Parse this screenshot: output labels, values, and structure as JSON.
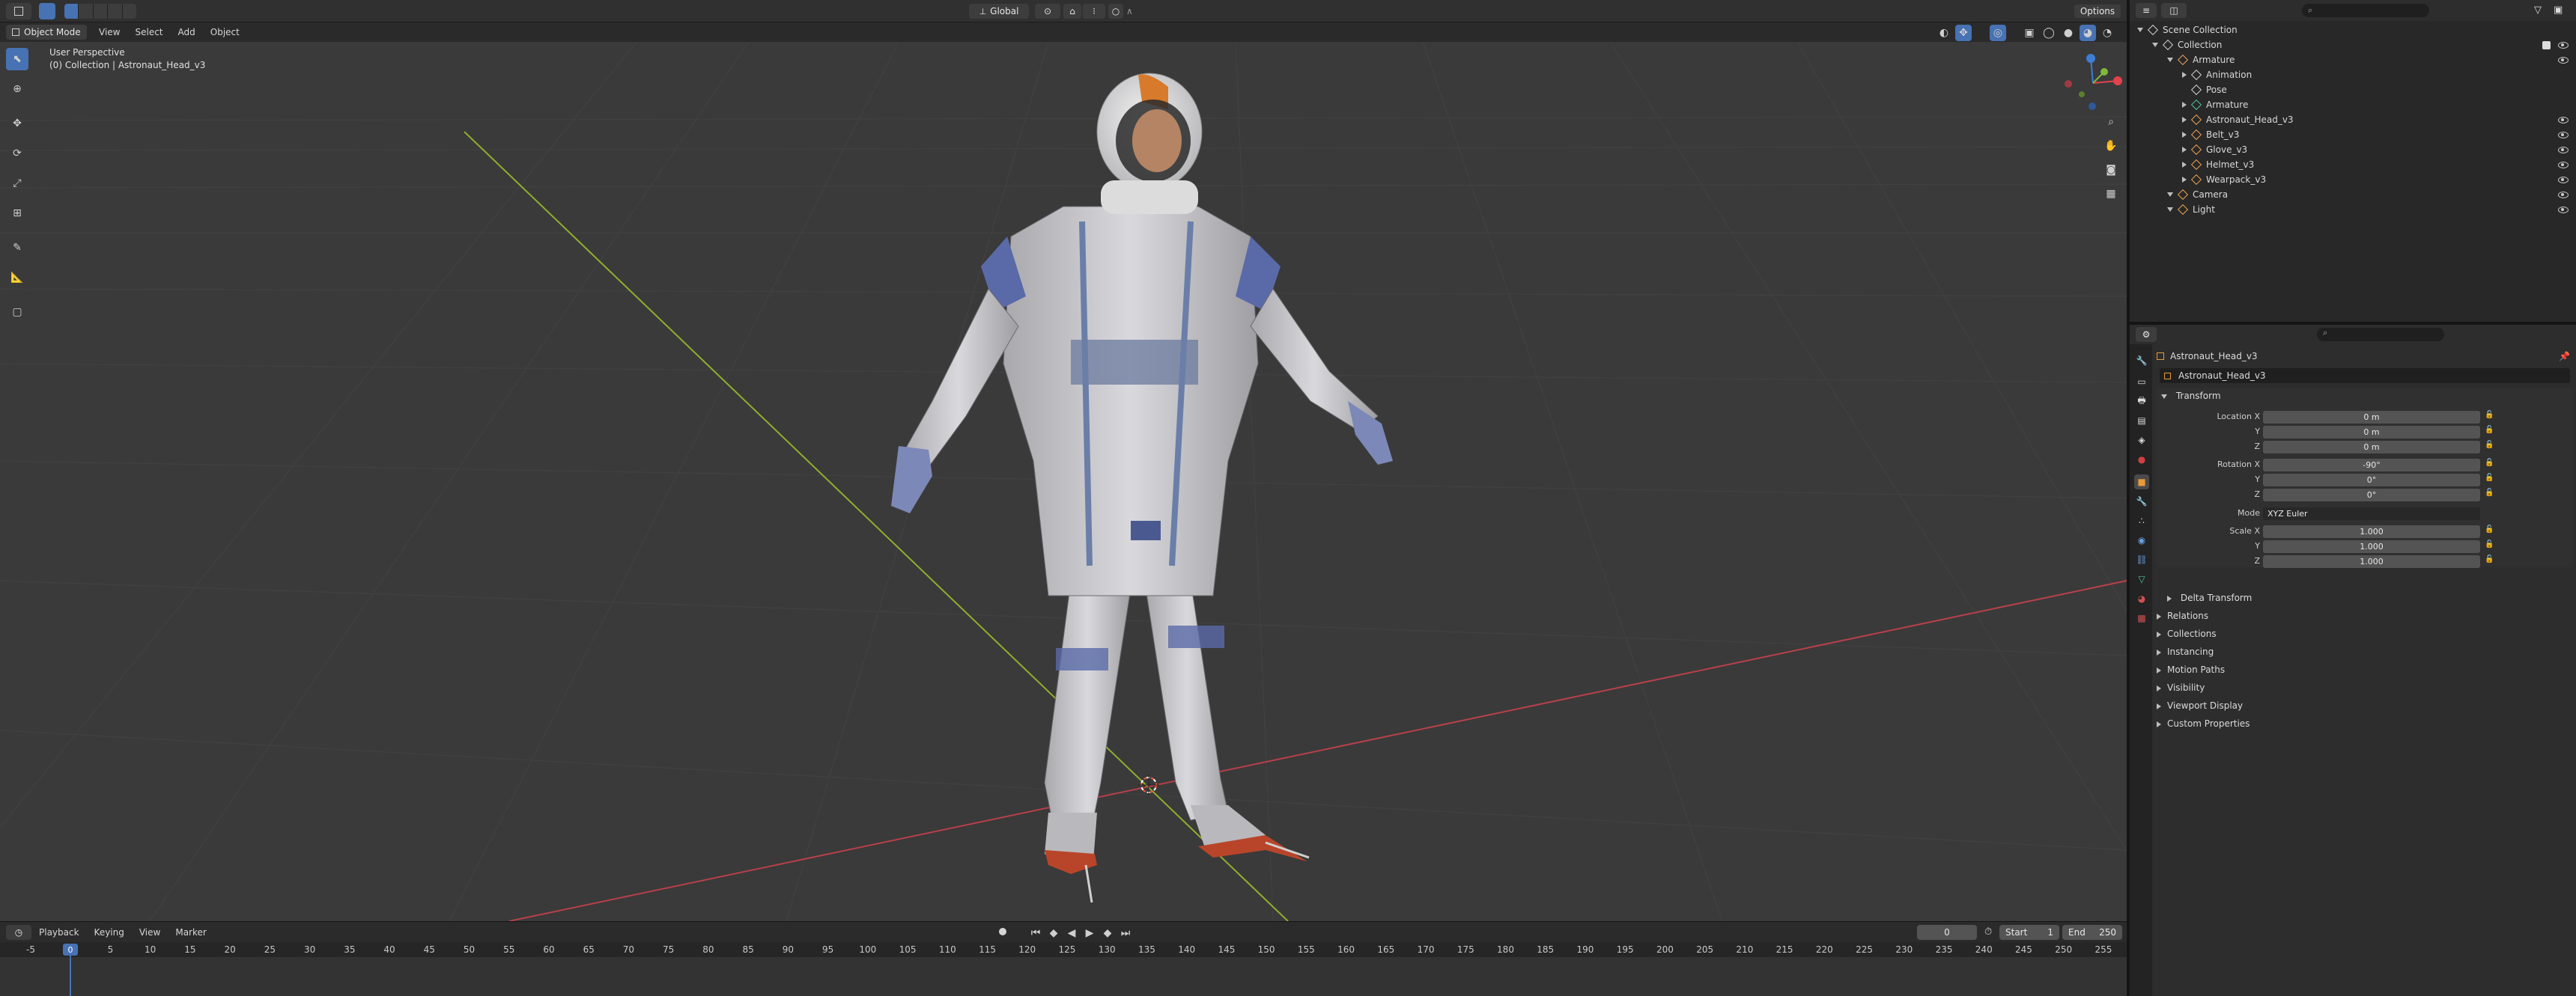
{
  "topbar": {
    "mode": "Object Mode",
    "menus": [
      "View",
      "Select",
      "Add",
      "Object"
    ],
    "transform_orientation": "Global",
    "options": "Options"
  },
  "viewport": {
    "perspective": "User Perspective",
    "collection_path": "(0) Collection | Astronaut_Head_v3"
  },
  "outliner": {
    "search_placeholder": "",
    "items": [
      {
        "label": "Scene Collection",
        "depth": 0,
        "icon": "scene-collection-icon",
        "color": "#cfcfcf"
      },
      {
        "label": "Collection",
        "depth": 1,
        "icon": "collection-icon",
        "color": "#cfcfcf",
        "visible": true
      },
      {
        "label": "Armature",
        "depth": 2,
        "icon": "armature-icon",
        "color": "#e0a060",
        "visible": true
      },
      {
        "label": "Animation",
        "depth": 3,
        "icon": "animation-icon",
        "color": "#cfcfcf"
      },
      {
        "label": "Pose",
        "depth": 3,
        "icon": "pose-icon",
        "color": "#cfcfcf"
      },
      {
        "label": "Armature",
        "depth": 3,
        "icon": "armature-data-icon",
        "color": "#4fc1a0"
      },
      {
        "label": "Astronaut_Head_v3",
        "depth": 3,
        "icon": "mesh-object-icon",
        "color": "#e8a050",
        "visible": true
      },
      {
        "label": "Belt_v3",
        "depth": 3,
        "icon": "mesh-object-icon",
        "color": "#e8a050",
        "visible": true
      },
      {
        "label": "Glove_v3",
        "depth": 3,
        "icon": "mesh-object-icon",
        "color": "#e8a050",
        "visible": true
      },
      {
        "label": "Helmet_v3",
        "depth": 3,
        "icon": "mesh-object-icon",
        "color": "#e8a050",
        "visible": true
      },
      {
        "label": "Wearpack_v3",
        "depth": 3,
        "icon": "mesh-object-icon",
        "color": "#e8a050",
        "visible": true
      },
      {
        "label": "Camera",
        "depth": 2,
        "icon": "camera-icon",
        "color": "#e8a050",
        "visible": true
      },
      {
        "label": "Light",
        "depth": 2,
        "icon": "light-icon",
        "color": "#e8a050",
        "visible": true
      }
    ]
  },
  "properties": {
    "object_name": "Astronaut_Head_v3",
    "name_field": "Astronaut_Head_v3",
    "transform_label": "Transform",
    "location_label": "Location X",
    "location": [
      "0 m",
      "0 m",
      "0 m"
    ],
    "rotation_label": "Rotation X",
    "rotation": [
      "-90°",
      "0°",
      "0°"
    ],
    "mode_label": "Mode",
    "mode_value": "XYZ Euler",
    "scale_label": "Scale X",
    "scale": [
      "1.000",
      "1.000",
      "1.000"
    ],
    "axis_y": "Y",
    "axis_z": "Z",
    "delta_transform": "Delta Transform",
    "sections": [
      "Relations",
      "Collections",
      "Instancing",
      "Motion Paths",
      "Visibility",
      "Viewport Display",
      "Custom Properties"
    ]
  },
  "timeline": {
    "menus": [
      "Playback",
      "Keying",
      "View",
      "Marker"
    ],
    "current_frame": "0",
    "start_label": "Start",
    "start_value": "1",
    "end_label": "End",
    "end_value": "250",
    "ticks": [
      "-5",
      "0",
      "5",
      "10",
      "15",
      "20",
      "25",
      "30",
      "35",
      "40",
      "45",
      "50",
      "55",
      "60",
      "65",
      "70",
      "75",
      "80",
      "85",
      "90",
      "95",
      "100",
      "105",
      "110",
      "115",
      "120",
      "125",
      "130",
      "135",
      "140",
      "145",
      "150",
      "155",
      "160",
      "165",
      "170",
      "175",
      "180",
      "185",
      "190",
      "195",
      "200",
      "205",
      "210",
      "215",
      "220",
      "225",
      "230",
      "235",
      "240",
      "245",
      "250",
      "255"
    ],
    "playhead_label": "0"
  },
  "colors": {
    "accent": "#4772b3",
    "x_axis": "#b8404a",
    "y_axis": "#8fae2e",
    "gizmo_x": "#e2424c",
    "gizmo_y": "#7fb83a",
    "gizmo_z": "#3d7ed8"
  }
}
